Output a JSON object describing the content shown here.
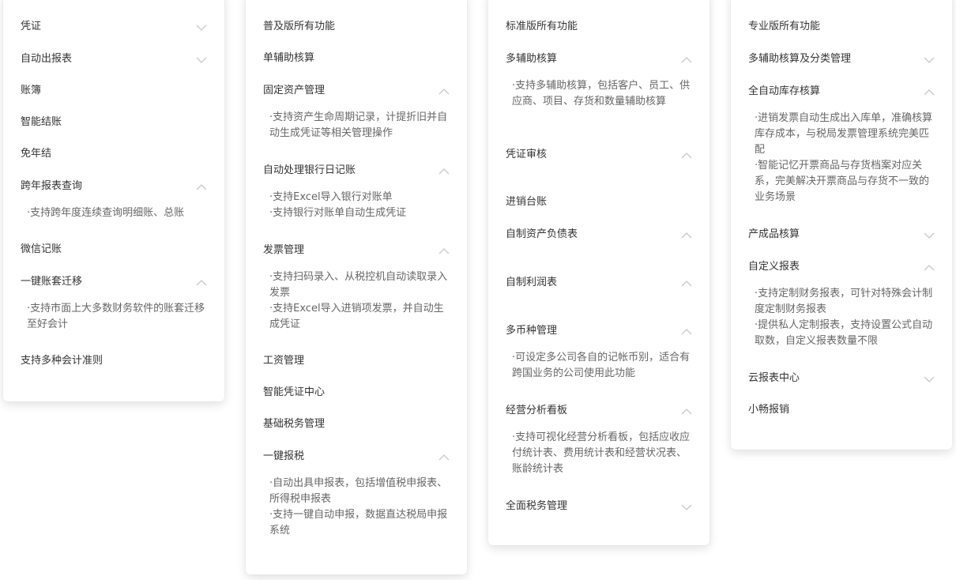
{
  "colors": {
    "text": "#333333",
    "description": "#666666",
    "chevron": "#c8c8c8",
    "card_bg": "#ffffff"
  },
  "basic": {
    "items": [
      {
        "label": "凭证"
      },
      {
        "label": "自动出报表"
      },
      {
        "label": "账簿"
      },
      {
        "label": "智能结账"
      },
      {
        "label": "免年结"
      },
      {
        "label": "跨年报表查询",
        "desc": [
          "·支持跨年度连续查询明细账、总账"
        ]
      },
      {
        "label": "微信记账"
      },
      {
        "label": "一键账套迁移",
        "desc": [
          "·支持市面上大多数财务软件的账套迁移至好会计"
        ]
      },
      {
        "label": "支持多种会计准则"
      }
    ]
  },
  "popular": {
    "items": [
      {
        "label": "普及版所有功能"
      },
      {
        "label": "单辅助核算"
      },
      {
        "label": "固定资产管理",
        "desc": [
          "·支持资产生命周期记录，计提折旧并自动生成凭证等相关管理操作"
        ]
      },
      {
        "label": "自动处理银行日记账",
        "desc": [
          "·支持Excel导入银行对账单",
          "·支持银行对账单自动生成凭证"
        ]
      },
      {
        "label": "发票管理",
        "desc": [
          "·支持扫码录入、从税控机自动读取录入发票",
          "·支持Excel导入进销项发票，并自动生成凭证"
        ]
      },
      {
        "label": "工资管理"
      },
      {
        "label": "智能凭证中心"
      },
      {
        "label": "基础税务管理"
      },
      {
        "label": "一键报税",
        "desc": [
          "·自动出具申报表，包括增值税申报表、所得税申报表",
          "·支持一键自动申报，数据直达税局申报系统"
        ]
      }
    ]
  },
  "standard": {
    "items": [
      {
        "label": "标准版所有功能"
      },
      {
        "label": "多辅助核算",
        "desc": [
          "·支持多辅助核算，包括客户、员工、供应商、项目、存货和数量辅助核算"
        ]
      },
      {
        "label": "凭证审核"
      },
      {
        "label": "进销台账"
      },
      {
        "label": "自制资产负债表"
      },
      {
        "label": "自制利润表"
      },
      {
        "label": "多币种管理",
        "desc": [
          "·可设定多公司各自的记帐币别，适合有跨国业务的公司使用此功能"
        ]
      },
      {
        "label": "经营分析看板",
        "desc": [
          "·支持可视化经营分析看板，包括应收应付统计表、费用统计表和经营状况表、账龄统计表"
        ]
      },
      {
        "label": "全面税务管理"
      }
    ]
  },
  "pro": {
    "items": [
      {
        "label": "专业版所有功能"
      },
      {
        "label": "多辅助核算及分类管理"
      },
      {
        "label": "全自动库存核算",
        "desc": [
          "·进销发票自动生成出入库单，准确核算库存成本，与税局发票管理系统完美匹配",
          "·智能记忆开票商品与存货档案对应关系，完美解决开票商品与存货不一致的业务场景"
        ]
      },
      {
        "label": "产成品核算"
      },
      {
        "label": "自定义报表",
        "desc": [
          "·支持定制财务报表，可针对特殊会计制度定制财务报表",
          "·提供私人定制报表，支持设置公式自动取数，自定义报表数量不限"
        ]
      },
      {
        "label": "云报表中心"
      },
      {
        "label": "小畅报销"
      }
    ]
  }
}
